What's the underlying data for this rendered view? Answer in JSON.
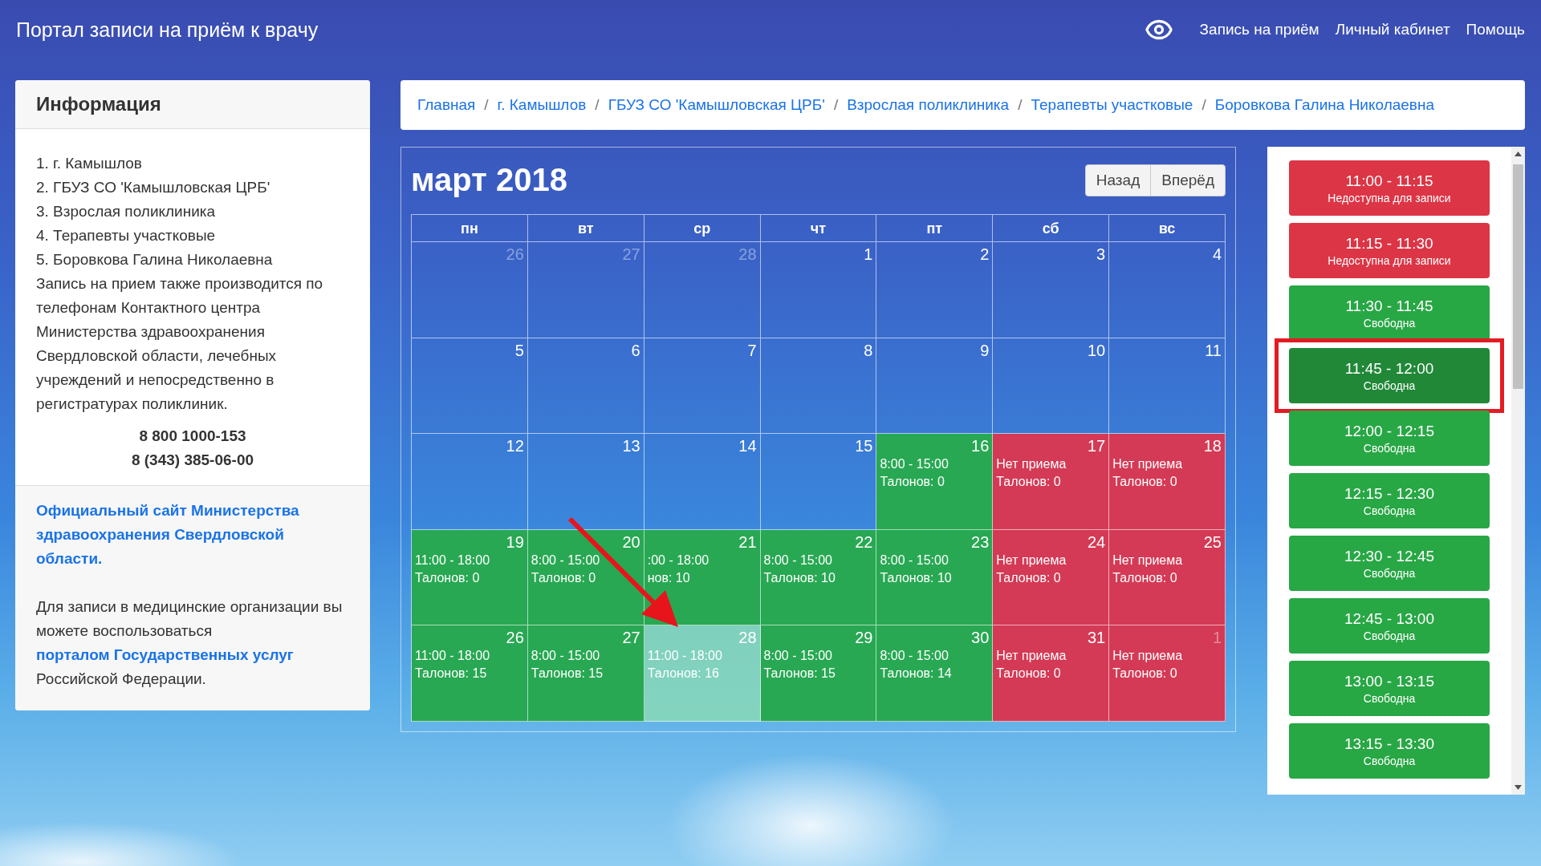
{
  "header": {
    "title": "Портал записи на приём к врачу",
    "nav": [
      "Запись на приём",
      "Личный кабинет",
      "Помощь"
    ]
  },
  "info": {
    "title": "Информация",
    "lines": [
      "1. г. Камышлов",
      "2. ГБУЗ СО 'Камышловская ЦРБ'",
      "3. Взрослая поликлиника",
      "4. Терапевты участковые",
      "5. Боровкова Галина Николаевна"
    ],
    "note": "Запись на прием также производится по телефонам Контактного центра Министерства здравоохранения Свердловской области, лечебных учреждений и непосредственно в регистратурах поликлиник.",
    "phones": [
      "8 800 1000-153",
      "8 (343) 385-06-00"
    ],
    "ministry_link": "Официальный сайт Министерства здравоохранения Свердловской области.",
    "portal": {
      "before": "Для записи в медицинские организации вы можете воспользоваться",
      "link": "порталом Государственных услуг",
      "after": "Российской Федерации."
    }
  },
  "breadcrumb": [
    {
      "label": "Главная"
    },
    {
      "separator": "/",
      "label": "г. Камышлов"
    },
    {
      "separator": "/",
      "label": "ГБУЗ СО 'Камышловская ЦРБ'"
    },
    {
      "separator": "/",
      "label": "Взрослая поликлиника"
    },
    {
      "separator": "/",
      "label": "Терапевты участковые"
    },
    {
      "separator": "/",
      "label": "Боровкова Галина Николаевна"
    }
  ],
  "calendar": {
    "title": "март 2018",
    "buttons": [
      "Назад",
      "Вперёд"
    ],
    "weekdays": [
      "пн",
      "вт",
      "ср",
      "чт",
      "пт",
      "сб",
      "вс"
    ],
    "days": [
      {
        "day": "26",
        "kind": "empty",
        "outside": true,
        "selected": false
      },
      {
        "day": "27",
        "kind": "empty",
        "outside": true,
        "selected": false
      },
      {
        "day": "28",
        "kind": "empty",
        "outside": true,
        "selected": false
      },
      {
        "day": "1",
        "kind": "empty",
        "outside": false,
        "selected": false
      },
      {
        "day": "2",
        "kind": "empty",
        "outside": false,
        "selected": false
      },
      {
        "day": "3",
        "kind": "empty",
        "outside": false,
        "selected": false
      },
      {
        "day": "4",
        "kind": "empty",
        "outside": false,
        "selected": false
      },
      {
        "day": "5",
        "kind": "empty",
        "outside": false,
        "selected": false
      },
      {
        "day": "6",
        "kind": "empty",
        "outside": false,
        "selected": false
      },
      {
        "day": "7",
        "kind": "empty",
        "outside": false,
        "selected": false
      },
      {
        "day": "8",
        "kind": "empty",
        "outside": false,
        "selected": false
      },
      {
        "day": "9",
        "kind": "empty",
        "outside": false,
        "selected": false
      },
      {
        "day": "10",
        "kind": "empty",
        "outside": false,
        "selected": false
      },
      {
        "day": "11",
        "kind": "empty",
        "outside": false,
        "selected": false
      },
      {
        "day": "12",
        "kind": "empty",
        "outside": false,
        "selected": false
      },
      {
        "day": "13",
        "kind": "empty",
        "outside": false,
        "selected": false
      },
      {
        "day": "14",
        "kind": "empty",
        "outside": false,
        "selected": false
      },
      {
        "day": "15",
        "kind": "empty",
        "outside": false,
        "selected": false
      },
      {
        "day": "16",
        "kind": "open",
        "outside": false,
        "selected": false,
        "hours": "8:00 - 15:00",
        "tickets": "Талонов: 0"
      },
      {
        "day": "17",
        "kind": "closed",
        "outside": false,
        "selected": false,
        "hours": "Нет приема",
        "tickets": "Талонов: 0"
      },
      {
        "day": "18",
        "kind": "closed",
        "outside": false,
        "selected": false,
        "hours": "Нет приема",
        "tickets": "Талонов: 0"
      },
      {
        "day": "19",
        "kind": "open",
        "outside": false,
        "selected": false,
        "hours": "11:00 - 18:00",
        "tickets": "Талонов: 0"
      },
      {
        "day": "20",
        "kind": "open",
        "outside": false,
        "selected": false,
        "hours": "8:00 - 15:00",
        "tickets": "Талонов: 0"
      },
      {
        "day": "21",
        "kind": "open",
        "outside": false,
        "selected": false,
        "hours": ":00 - 18:00",
        "tickets": "нов: 10"
      },
      {
        "day": "22",
        "kind": "open",
        "outside": false,
        "selected": false,
        "hours": "8:00 - 15:00",
        "tickets": "Талонов: 10"
      },
      {
        "day": "23",
        "kind": "open",
        "outside": false,
        "selected": false,
        "hours": "8:00 - 15:00",
        "tickets": "Талонов: 10"
      },
      {
        "day": "24",
        "kind": "closed",
        "outside": false,
        "selected": false,
        "hours": "Нет приема",
        "tickets": "Талонов: 0"
      },
      {
        "day": "25",
        "kind": "closed",
        "outside": false,
        "selected": false,
        "hours": "Нет приема",
        "tickets": "Талонов: 0"
      },
      {
        "day": "26",
        "kind": "open",
        "outside": false,
        "selected": false,
        "hours": "11:00 - 18:00",
        "tickets": "Талонов: 15"
      },
      {
        "day": "27",
        "kind": "open",
        "outside": false,
        "selected": false,
        "hours": "8:00 - 15:00",
        "tickets": "Талонов: 15"
      },
      {
        "day": "28",
        "kind": "open",
        "outside": false,
        "selected": true,
        "hours": "11:00 - 18:00",
        "tickets": "Талонов: 16"
      },
      {
        "day": "29",
        "kind": "open",
        "outside": false,
        "selected": false,
        "hours": "8:00 - 15:00",
        "tickets": "Талонов: 15"
      },
      {
        "day": "30",
        "kind": "open",
        "outside": false,
        "selected": false,
        "hours": "8:00 - 15:00",
        "tickets": "Талонов: 14"
      },
      {
        "day": "31",
        "kind": "closed",
        "outside": false,
        "selected": false,
        "hours": "Нет приема",
        "tickets": "Талонов: 0"
      },
      {
        "day": "1",
        "kind": "closed",
        "outside": true,
        "selected": false,
        "hours": "Нет приема",
        "tickets": "Талонов: 0"
      }
    ]
  },
  "slots": [
    {
      "time": "11:00 - 11:15",
      "status": "Недоступна для записи",
      "kind": "unavailable",
      "selected": false
    },
    {
      "time": "11:15 - 11:30",
      "status": "Недоступна для записи",
      "kind": "unavailable",
      "selected": false
    },
    {
      "time": "11:30 - 11:45",
      "status": "Свободна",
      "kind": "free",
      "selected": false
    },
    {
      "time": "11:45 - 12:00",
      "status": "Свободна",
      "kind": "free",
      "selected": true
    },
    {
      "time": "12:00 - 12:15",
      "status": "Свободна",
      "kind": "free",
      "selected": false
    },
    {
      "time": "12:15 - 12:30",
      "status": "Свободна",
      "kind": "free",
      "selected": false
    },
    {
      "time": "12:30 - 12:45",
      "status": "Свободна",
      "kind": "free",
      "selected": false
    },
    {
      "time": "12:45 - 13:00",
      "status": "Свободна",
      "kind": "free",
      "selected": false
    },
    {
      "time": "13:00 - 13:15",
      "status": "Свободна",
      "kind": "free",
      "selected": false
    },
    {
      "time": "13:15 - 13:30",
      "status": "Свободна",
      "kind": "free",
      "selected": false
    }
  ]
}
